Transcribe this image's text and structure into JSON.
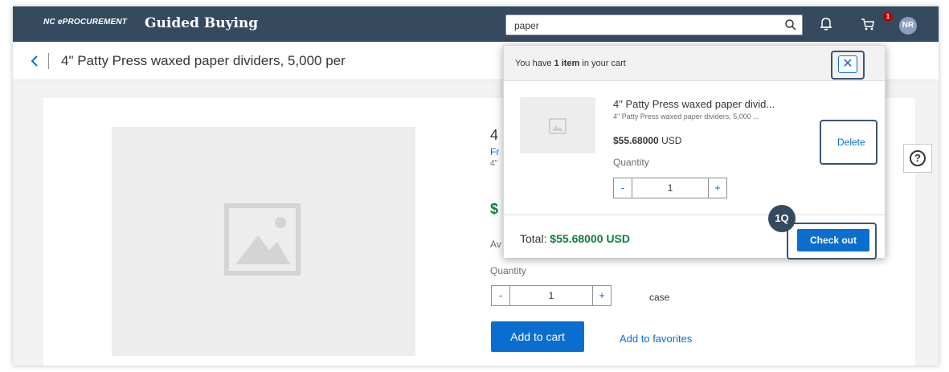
{
  "header": {
    "brand_small": "NC ePROCUREMENT",
    "brand_title": "Guided Buying",
    "search_value": "paper",
    "cart_count": "1",
    "avatar_initials": "NR"
  },
  "titlebar": {
    "title": "4\" Patty Press waxed paper dividers, 5,000 per"
  },
  "product": {
    "peek_title": "4",
    "peek_link": "Fr",
    "peek_desc": "4\"",
    "peek_price": "$",
    "peek_avail": "Av",
    "quantity_label": "Quantity",
    "quantity": "1",
    "unit": "case",
    "minus": "-",
    "plus": "+",
    "add_to_cart": "Add to cart",
    "add_to_favorites": "Add to favorites"
  },
  "help": {
    "label": "?"
  },
  "cart_popover": {
    "header_prefix": "You have ",
    "header_count": "1 item",
    "header_suffix": " in your cart",
    "close_label": "✕",
    "item": {
      "name": "4\" Patty Press waxed paper divid...",
      "sub": "4\" Patty Press waxed paper dividers, 5,000 ...",
      "price": "$55.68000",
      "currency": "USD",
      "quantity_label": "Quantity",
      "quantity": "1",
      "minus": "-",
      "plus": "+",
      "delete_label": "Delete"
    },
    "total_label": "Total:",
    "total_amount": "$55.68000",
    "total_currency": "USD",
    "checkout_label": "Check out"
  },
  "step_marker": "1Q",
  "colors": {
    "shell": "#354a5f",
    "accent": "#0a6ed1",
    "total_green": "#107e3e",
    "badge_red": "#bb0000"
  }
}
